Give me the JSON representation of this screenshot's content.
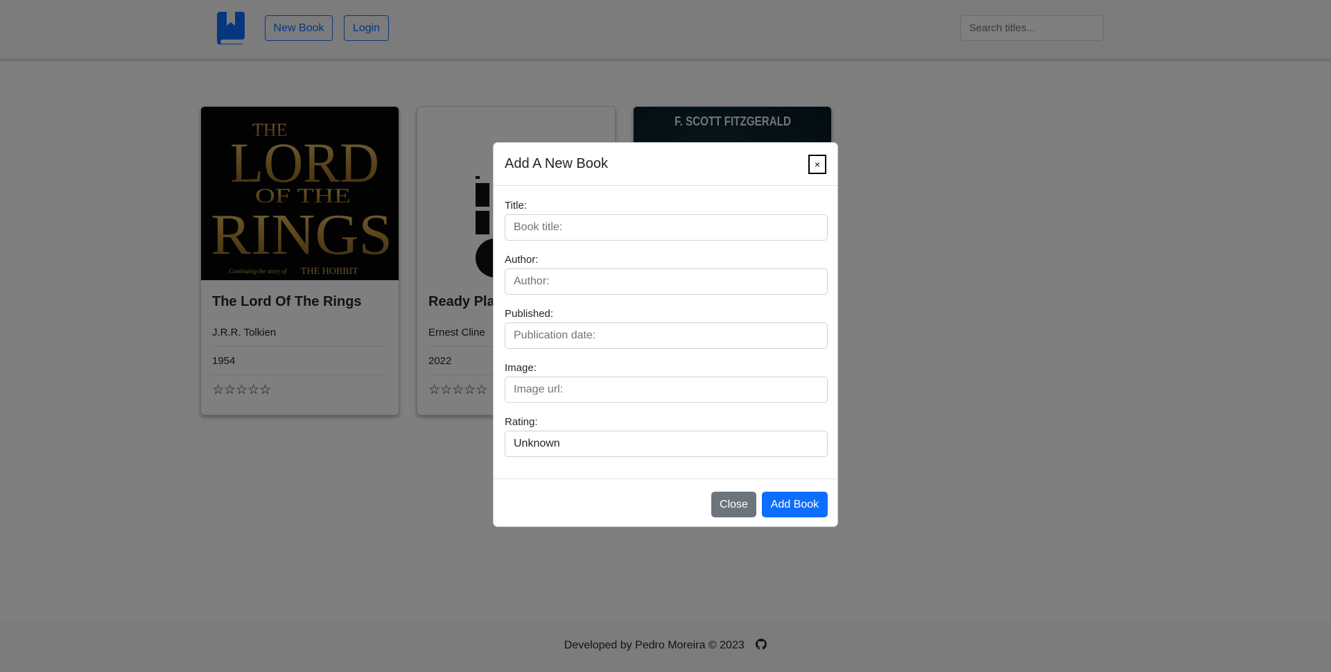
{
  "nav": {
    "new_book_label": "New Book",
    "login_label": "Login",
    "search_placeholder": "Search titles..."
  },
  "books": [
    {
      "title": "The Lord Of The Rings",
      "author": "J.R.R. Tolkien",
      "year": "1954",
      "rating": 0,
      "stars": "☆☆☆☆☆",
      "cover_text": [
        "THE",
        "LORD",
        "OF THE",
        "RINGS"
      ],
      "cover_tagline": "Continuing the story of",
      "cover_sub": "THE HOBBIT"
    },
    {
      "title": "Ready Play",
      "author": "Ernest Cline",
      "year": "2022",
      "rating": 0,
      "stars": "☆☆☆☆☆"
    },
    {
      "title": "",
      "author": "",
      "year": "",
      "cover_author": "F. SCOTT FITZGERALD"
    }
  ],
  "modal": {
    "title": "Add A New Book",
    "close_x": "×",
    "fields": [
      {
        "label": "Title:",
        "placeholder": "Book title:",
        "value": ""
      },
      {
        "label": "Author:",
        "placeholder": "Author:",
        "value": ""
      },
      {
        "label": "Published:",
        "placeholder": "Publication date:",
        "value": ""
      },
      {
        "label": "Image:",
        "placeholder": "Image url:",
        "value": ""
      },
      {
        "label": "Rating:",
        "placeholder": "",
        "value": "Unknown"
      }
    ],
    "close_label": "Close",
    "add_label": "Add Book"
  },
  "footer": {
    "text": "Developed by Pedro Moreira © 2023"
  },
  "colors": {
    "primary": "#0d6efd",
    "secondary": "#6c757d",
    "gold": "#c9a24a"
  }
}
